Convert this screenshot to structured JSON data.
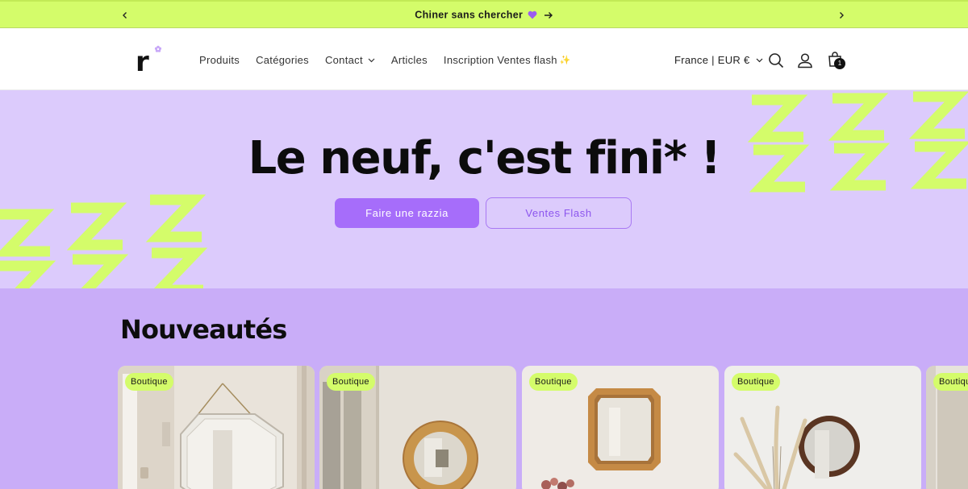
{
  "announcement": {
    "message": "Chiner sans chercher",
    "prev_icon": "chevron-left-icon",
    "next_icon": "chevron-right-icon",
    "accent": "#d4fc6a",
    "heart_color": "#9b5cf0"
  },
  "header": {
    "logo_letter": "r",
    "nav": [
      "Produits",
      "Catégories",
      "Contact",
      "Articles",
      "Inscription Ventes flash"
    ],
    "sparkle": "✨",
    "locale": "France | EUR €",
    "cart_count": "1"
  },
  "hero": {
    "title": "Le neuf, c'est fini* !",
    "primary_button": "Faire une razzia",
    "secondary_button": "Ventes Flash",
    "background": "#dccbfc",
    "pattern_color": "#d4fc6a",
    "button_color": "#a66dfa"
  },
  "new_arrivals": {
    "title": "Nouveautés",
    "background": "#c9adf8",
    "cards": [
      {
        "badge": "Boutique",
        "subject": "octagonal beveled mirror hanging on chain"
      },
      {
        "badge": "Boutique",
        "subject": "round pine wood frame mirror"
      },
      {
        "badge": "Boutique",
        "subject": "octagonal pine wood frame mirror"
      },
      {
        "badge": "Boutique",
        "subject": "round dark wood mirror with dried pampas"
      },
      {
        "badge": "Boutique",
        "subject": "partially visible product"
      }
    ]
  }
}
